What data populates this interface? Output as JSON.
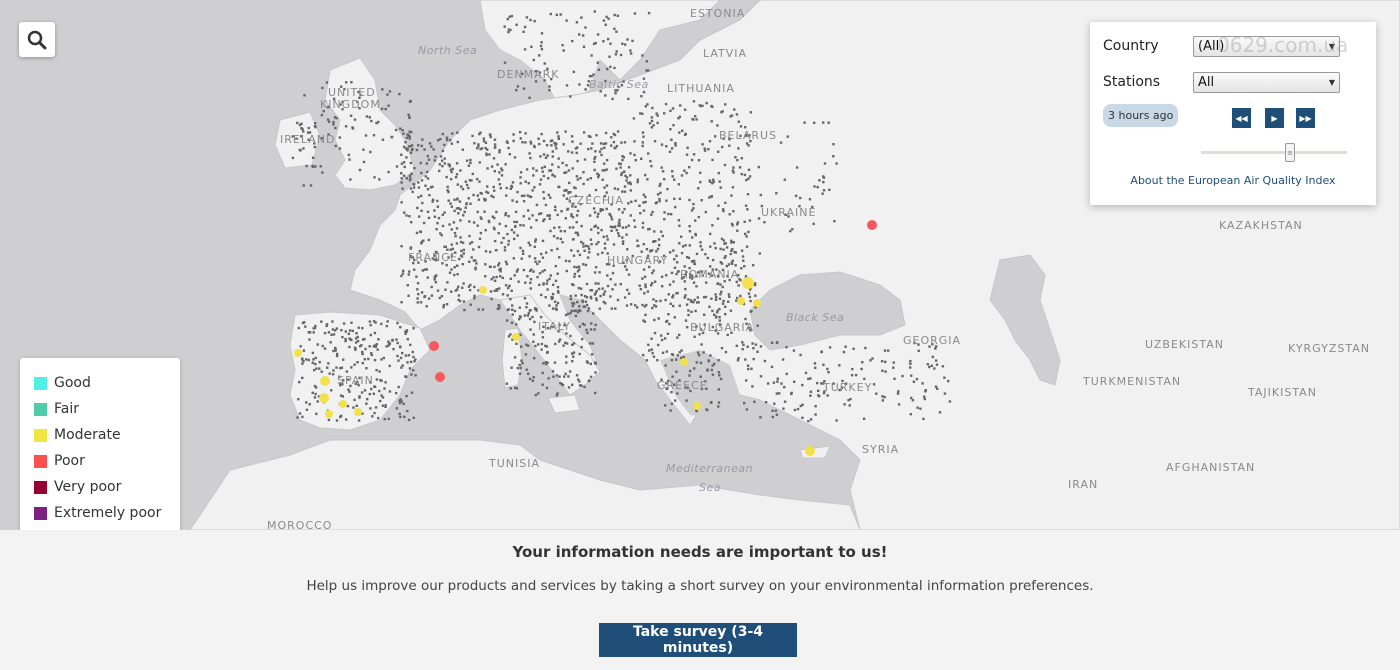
{
  "search": {
    "icon": "search-icon"
  },
  "map": {
    "land_labels": [
      {
        "id": "estonia",
        "text": "ESTONIA"
      },
      {
        "id": "latvia",
        "text": "LATVIA"
      },
      {
        "id": "lithuania",
        "text": "LITHUANIA"
      },
      {
        "id": "denmark",
        "text": "DENMARK"
      },
      {
        "id": "uk1",
        "text": "UNITED"
      },
      {
        "id": "uk2",
        "text": "KINGDOM"
      },
      {
        "id": "ireland",
        "text": "IRELAND"
      },
      {
        "id": "belarus",
        "text": "BELARUS"
      },
      {
        "id": "czechia",
        "text": "CZECHIA"
      },
      {
        "id": "ukraine",
        "text": "UKRAINE"
      },
      {
        "id": "kazakhstan",
        "text": "KAZAKHSTAN"
      },
      {
        "id": "france",
        "text": "FRANCE"
      },
      {
        "id": "hungary",
        "text": "HUNGARY"
      },
      {
        "id": "romania",
        "text": "ROMANIA"
      },
      {
        "id": "italy",
        "text": "ITALY"
      },
      {
        "id": "bulgaria",
        "text": "BULGARIA"
      },
      {
        "id": "georgia",
        "text": "GEORGIA"
      },
      {
        "id": "uzbekistan",
        "text": "UZBEKISTAN"
      },
      {
        "id": "kyrgyzstan",
        "text": "KYRGYZSTAN"
      },
      {
        "id": "spain",
        "text": "SPAIN"
      },
      {
        "id": "greece",
        "text": "GREECE"
      },
      {
        "id": "turkey",
        "text": "TURKEY"
      },
      {
        "id": "turkmenistan",
        "text": "TURKMENISTAN"
      },
      {
        "id": "tajikistan",
        "text": "TAJIKISTAN"
      },
      {
        "id": "syria",
        "text": "SYRIA"
      },
      {
        "id": "tunisia",
        "text": "TUNISIA"
      },
      {
        "id": "afghanistan",
        "text": "AFGHANISTAN"
      },
      {
        "id": "iran",
        "text": "IRAN"
      },
      {
        "id": "morocco",
        "text": "MOROCCO"
      }
    ],
    "sea_labels": [
      {
        "id": "northsea",
        "text": "North Sea"
      },
      {
        "id": "baltic",
        "text": "Baltic Sea"
      },
      {
        "id": "blacksea",
        "text": "Black Sea"
      },
      {
        "id": "med1",
        "text": "Mediterranean"
      },
      {
        "id": "med2",
        "text": "Sea"
      }
    ],
    "colors": {
      "sea": "#cfcfd1",
      "land": "#f1f1f1",
      "station": "#666666",
      "moderate": "#f2e14c",
      "poor": "#f4595d"
    }
  },
  "legend": {
    "items": [
      {
        "label": "Good",
        "color": "#50f0e6"
      },
      {
        "label": "Fair",
        "color": "#50ccaa"
      },
      {
        "label": "Moderate",
        "color": "#f0e641"
      },
      {
        "label": "Poor",
        "color": "#ff5050"
      },
      {
        "label": "Very poor",
        "color": "#960032"
      },
      {
        "label": "Extremely poor",
        "color": "#7d2181"
      }
    ]
  },
  "panel": {
    "country_label": "Country",
    "country_value": "(All)",
    "stations_label": "Stations",
    "stations_value": "All",
    "time_badge": "3 hours ago",
    "rewind_icon": "rewind-icon",
    "play_icon": "play-icon",
    "fast_forward_icon": "fast-forward-icon",
    "about_link": "About the European Air Quality Index"
  },
  "watermark": "0629.com.ua",
  "survey": {
    "title": "Your information needs are important to us!",
    "text": "Help us improve our products and services by taking a short survey on your environmental information preferences.",
    "button": "Take survey (3-4 minutes)"
  }
}
